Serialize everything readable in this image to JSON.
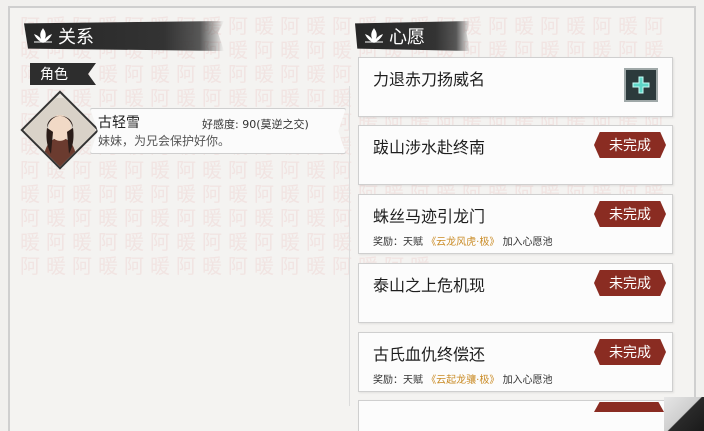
{
  "relations": {
    "title": "关系",
    "role_tab": "角色",
    "character": {
      "name": "古轻雪",
      "favor_label": "好感度:",
      "favor_value": "90(莫逆之交)",
      "line": "妹妹，为兄会保护好你。"
    }
  },
  "wishes": {
    "title": "心愿",
    "items": [
      {
        "title": "力退赤刀扬威名",
        "status": "",
        "reward": null
      },
      {
        "title": "跋山涉水赴终南",
        "status": "未完成",
        "reward": null
      },
      {
        "title": "蛛丝马迹引龙门",
        "status": "未完成",
        "reward": {
          "prefix": "奖励：天赋",
          "talent": "《云龙风虎·极》",
          "suffix": "加入心愿池"
        }
      },
      {
        "title": "泰山之上危机现",
        "status": "未完成",
        "reward": null
      },
      {
        "title": "古氏血仇终偿还",
        "status": "未完成",
        "reward": {
          "prefix": "奖励：天赋",
          "talent": "《云起龙骧·极》",
          "suffix": "加入心愿池"
        }
      }
    ]
  },
  "watermark_text": "阿暖阿暖阿暖阿暖阿暖阿暖阿暖阿暖阿暖阿暖阿暖阿暖阿暖阿暖阿暖阿暖阿暖阿暖阿暖阿暖阿暖阿暖阿暖阿暖阿暖阿暖阿暖阿暖阿暖阿暖阿暖阿暖阿暖阿暖阿暖阿暖阿暖阿暖阿暖阿暖阿暖阿暖阿暖阿暖阿暖阿暖阿暖阿暖阿暖阿暖阿暖阿暖阿暖阿暖阿暖阿暖阿暖阿暖阿暖阿暖阿暖阿暖阿暖阿暖阿暖阿暖阿暖阿暖阿暖阿暖阿暖阿暖阿暖阿暖阿暖阿暖阿暖阿暖阿暖阿暖阿暖阿暖阿暖阿暖阿暖阿暖阿暖阿暖阿暖阿暖阿暖阿暖阿暖阿暖阿暖阿暖阿暖阿暖阿暖阿暖阿暖阿暖阿暖阿暖阿暖阿暖阿暖阿暖阿暖阿暖阿暖阿暖阿暖阿暖阿暖阿暖阿暖阿暖阿暖阿暖阿暖阿暖阿暖阿暖阿暖阿暖阿暖阿暖阿暖阿暖阿暖阿暖阿暖",
  "colors": {
    "badge": "#8a2c22",
    "talent": "#c98a23",
    "header": "#262626"
  }
}
